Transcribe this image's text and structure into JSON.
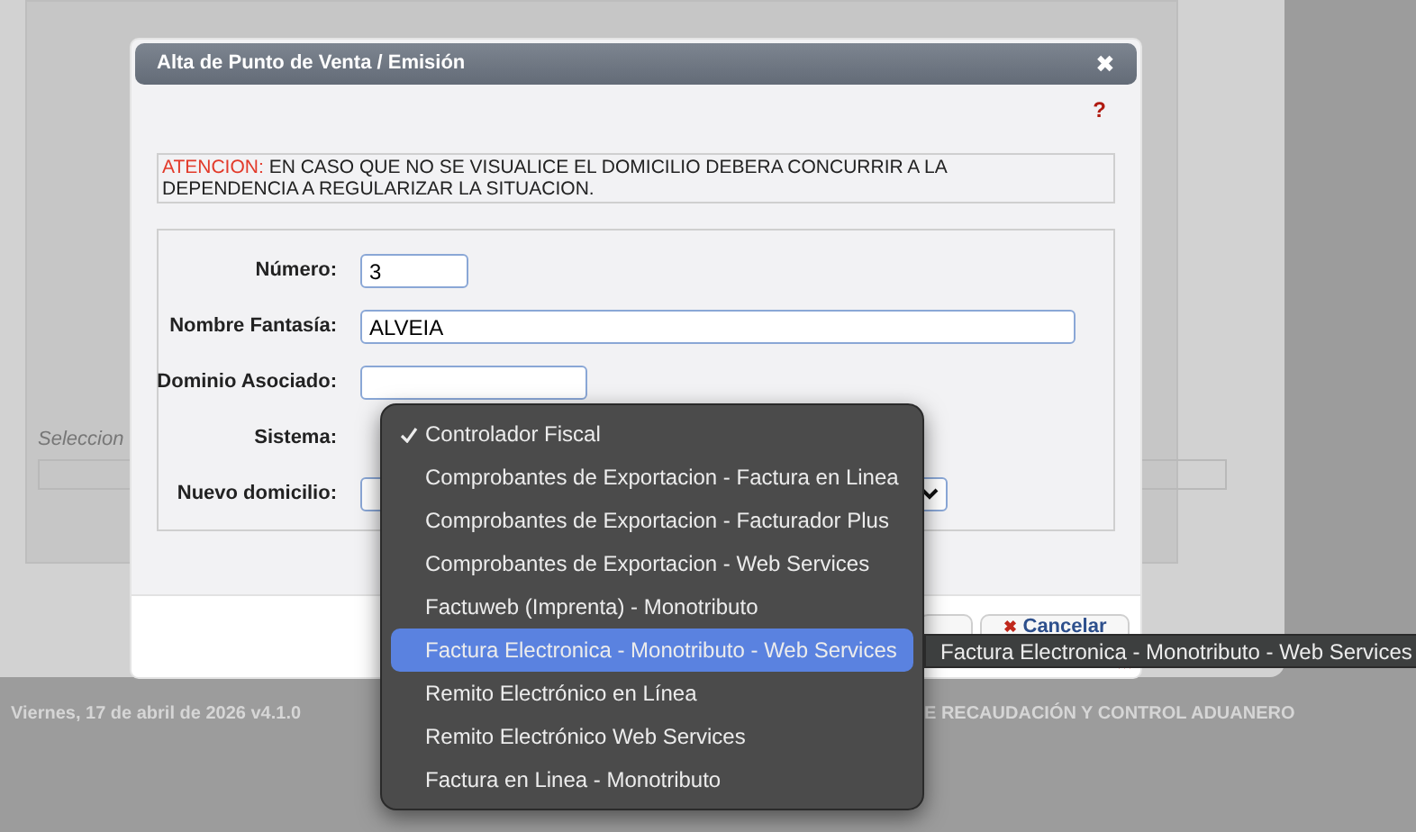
{
  "background": {
    "hint": "Seleccion",
    "footer_date": "Viernes, 17 de abril de 2026 v4.1.0",
    "footer_org": "E RECAUDACIÓN Y CONTROL ADUANERO"
  },
  "dialog": {
    "title": "Alta de Punto de Venta / Emisión",
    "close": "✖",
    "help": "?",
    "notice": {
      "label": "ATENCION:",
      "text": "EN CASO QUE NO SE VISUALICE EL DOMICILIO DEBERA CONCURRIR A LA DEPENDENCIA A REGULARIZAR LA SITUACION."
    },
    "fields": [
      {
        "label": "Número:",
        "kind": "text",
        "value": "3"
      },
      {
        "label": "Nombre Fantasía:",
        "kind": "text",
        "value": "ALVEIA"
      },
      {
        "label": "Dominio Asociado:",
        "kind": "text"
      },
      {
        "label": "Sistema:",
        "kind": "open-select"
      },
      {
        "label": "Nuevo domicilio:",
        "kind": "select"
      }
    ],
    "buttons": [
      {
        "label": "Cancelar",
        "icon": "✖"
      }
    ]
  },
  "dropdown": {
    "items": [
      {
        "label": "Controlador Fiscal",
        "checked": true,
        "highlighted": false
      },
      {
        "label": "Comprobantes de Exportacion - Factura en Linea",
        "checked": false,
        "highlighted": false
      },
      {
        "label": "Comprobantes de Exportacion - Facturador Plus",
        "checked": false,
        "highlighted": false
      },
      {
        "label": "Comprobantes de Exportacion - Web Services",
        "checked": false,
        "highlighted": false
      },
      {
        "label": "Factuweb (Imprenta) - Monotributo",
        "checked": false,
        "highlighted": false
      },
      {
        "label": "Factura Electronica - Monotributo - Web Services",
        "checked": false,
        "highlighted": true
      },
      {
        "label": "Remito Electrónico en Línea",
        "checked": false,
        "highlighted": false
      },
      {
        "label": "Remito Electrónico Web Services",
        "checked": false,
        "highlighted": false
      },
      {
        "label": "Factura en Linea - Monotributo",
        "checked": false,
        "highlighted": false
      }
    ]
  },
  "tooltip": {
    "text": "Factura Electronica - Monotributo - Web Services"
  }
}
